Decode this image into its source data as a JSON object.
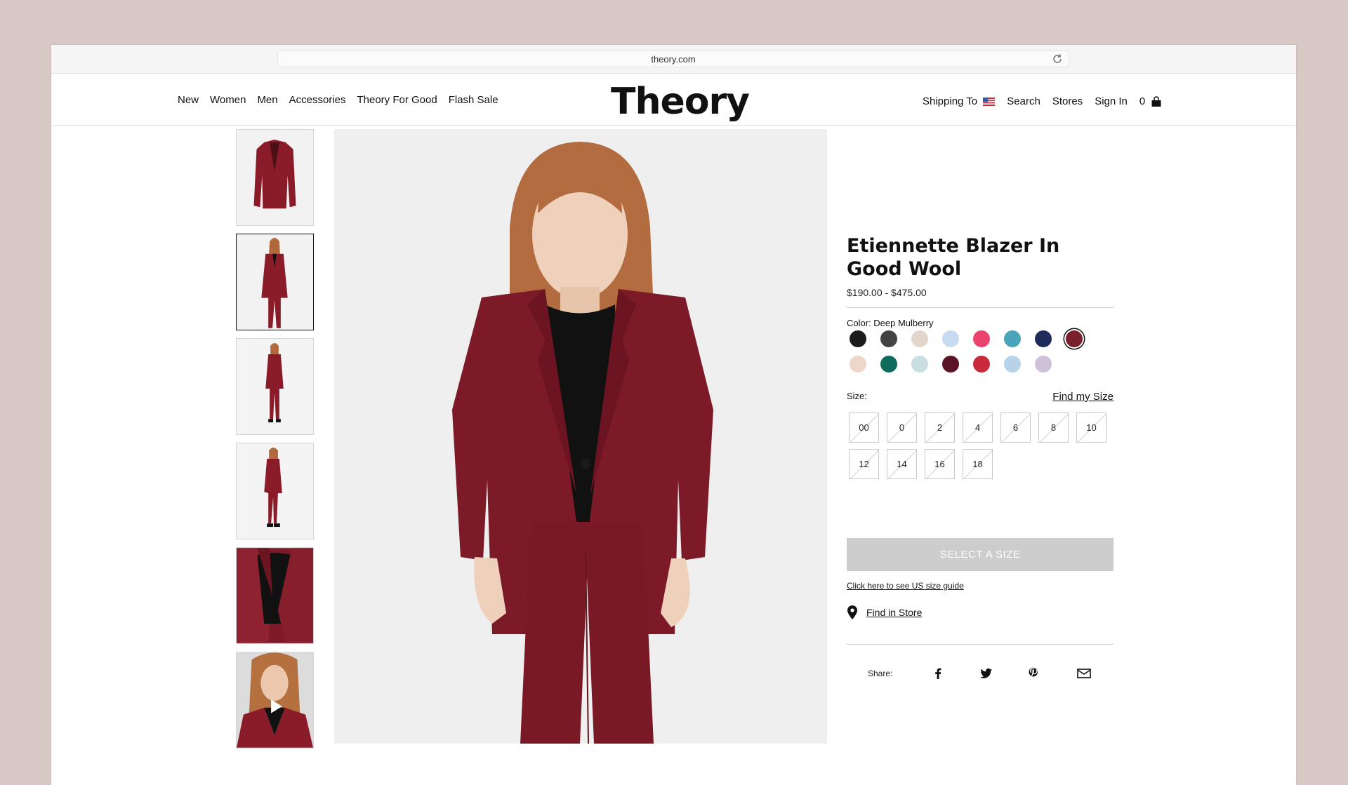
{
  "browser": {
    "url": "theory.com"
  },
  "nav": {
    "left": [
      "New",
      "Women",
      "Men",
      "Accessories",
      "Theory For Good",
      "Flash Sale"
    ],
    "logo": "Theory",
    "shipping": "Shipping To",
    "search": "Search",
    "stores": "Stores",
    "sign_in": "Sign In",
    "bag_count": "0"
  },
  "product": {
    "title": "Etiennette Blazer In Good Wool",
    "price": "$190.00 - $475.00",
    "color_label": "Color: Deep Mulberry",
    "swatches": [
      {
        "color": "#1c1c1c"
      },
      {
        "color": "#434343"
      },
      {
        "color": "#e3d5cc"
      },
      {
        "color": "#c8daf0"
      },
      {
        "color": "#e9436e"
      },
      {
        "color": "#4aa5ba"
      },
      {
        "color": "#1f2b5a"
      },
      {
        "color": "#7a1f2c",
        "selected": true
      },
      {
        "color": "#eed6c9"
      },
      {
        "color": "#0f6b5b"
      },
      {
        "color": "#c9dee0"
      },
      {
        "color": "#5a1426"
      },
      {
        "color": "#c92a3b"
      },
      {
        "color": "#b6d3ea"
      },
      {
        "color": "#cfc2d8"
      }
    ],
    "size_label": "Size:",
    "find_size": "Find my Size",
    "sizes": [
      "00",
      "0",
      "2",
      "4",
      "6",
      "8",
      "10",
      "12",
      "14",
      "16",
      "18"
    ],
    "select_button": "SELECT A SIZE",
    "size_guide": "Click here to see US size guide",
    "find_in_store": "Find in Store",
    "share_label": "Share:"
  },
  "icons": [
    "reload-icon",
    "us-flag-icon",
    "shopping-bag-icon",
    "location-pin-icon",
    "facebook-icon",
    "twitter-icon",
    "pinterest-icon",
    "email-icon",
    "play-icon"
  ],
  "colors": {
    "accent": "#7a1f2c",
    "button_disabled": "#cdcdcd",
    "background": "#d8c9c6"
  }
}
